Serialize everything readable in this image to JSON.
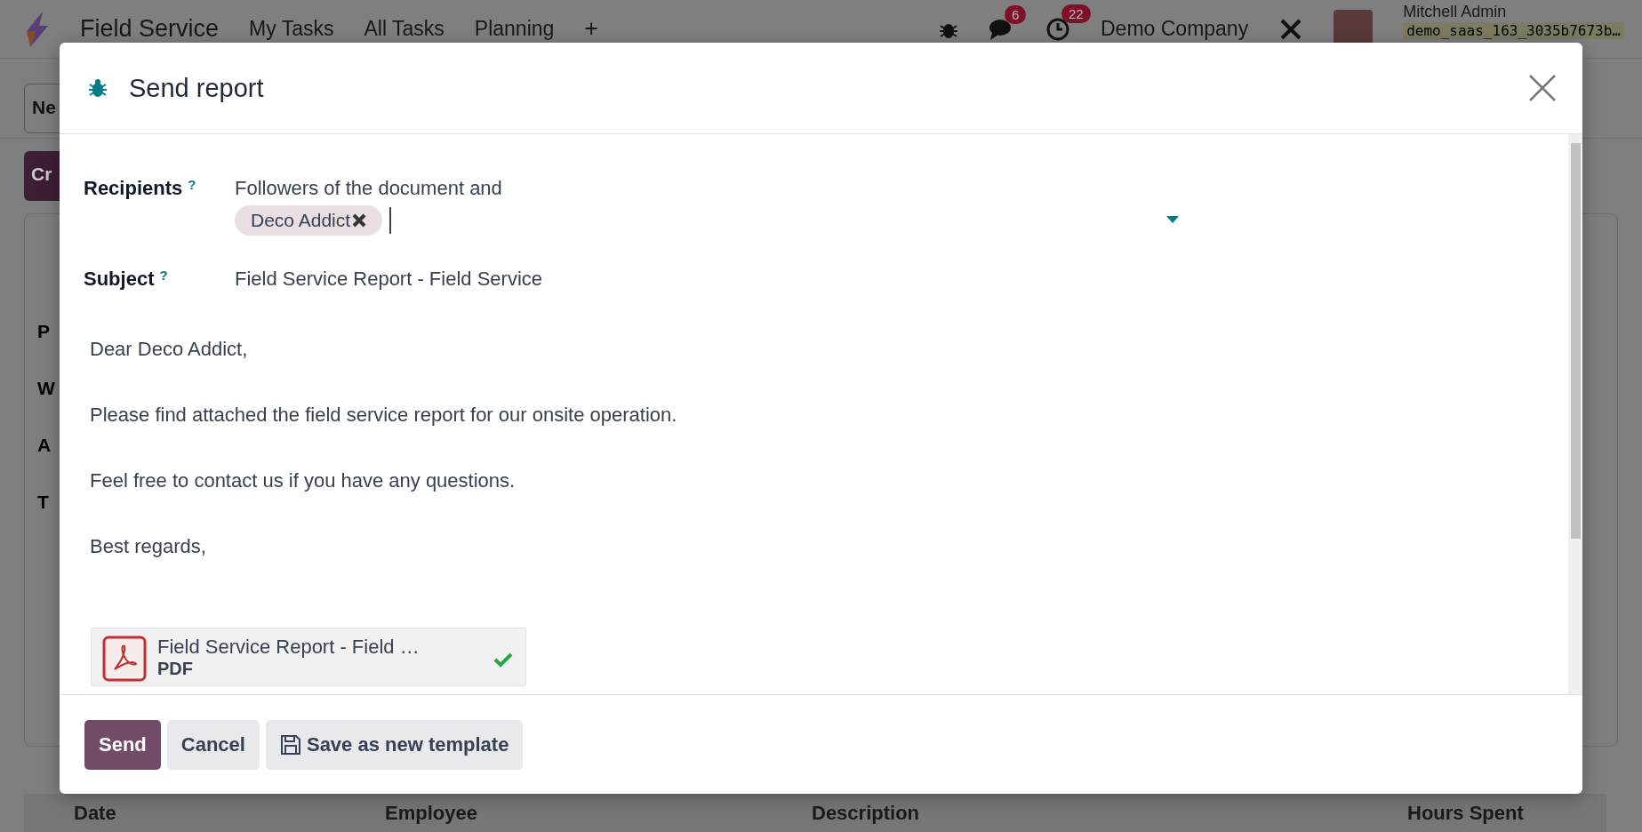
{
  "navbar": {
    "app_name": "Field Service",
    "menu": [
      "My Tasks",
      "All Tasks",
      "Planning"
    ],
    "new_label": "+",
    "messages_count": "6",
    "activities_count": "22",
    "company": "Demo Company",
    "user_name": "Mitchell Admin",
    "database": "demo_saas_163_3035b7673b…"
  },
  "control_panel": {
    "button_1": "Ne",
    "button_2": "Cr"
  },
  "form_labels": [
    "P",
    "W",
    "A",
    "T"
  ],
  "table": {
    "columns": [
      "Date",
      "Employee",
      "Description",
      "Hours Spent"
    ]
  },
  "dialog": {
    "title": "Send report",
    "fields": [
      {
        "label": "Recipients",
        "help": "?",
        "value": "Followers of the document and",
        "tags": [
          {
            "label": "Deco Addict"
          }
        ]
      },
      {
        "label": "Subject",
        "help": "?",
        "value": "Field Service Report - Field Service"
      }
    ],
    "body": [
      "Dear Deco Addict,",
      "Please find attached the field service report for our onsite operation.",
      "Feel free to contact us if you have any questions.",
      "Best regards,"
    ],
    "attachment": {
      "name": "Field Service Report - Field …",
      "type": "PDF",
      "uploaded": true
    },
    "buttons": [
      {
        "label": "Send",
        "kind": "primary"
      },
      {
        "label": "Cancel",
        "kind": "secondary"
      },
      {
        "label": "Save as new template",
        "kind": "save"
      }
    ]
  }
}
